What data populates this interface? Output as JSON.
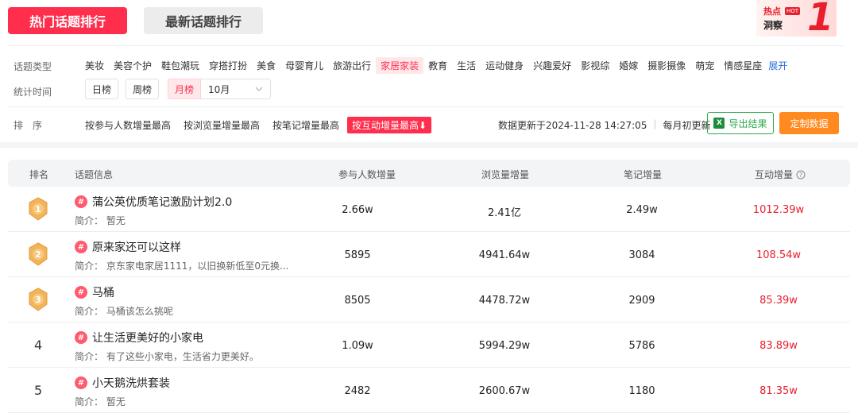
{
  "tabs": [
    {
      "label": "热门话题排行",
      "active": true
    },
    {
      "label": "最新话题排行",
      "active": false
    }
  ],
  "hot_banner": {
    "title": "热点",
    "badge": "HOT",
    "subtitle": "洞察",
    "number": "1"
  },
  "filters": {
    "topic_type_label": "话题类型",
    "topic_types": [
      "美妆",
      "美容个护",
      "鞋包潮玩",
      "穿搭打扮",
      "美食",
      "母婴育儿",
      "旅游出行",
      "家居家装",
      "教育",
      "生活",
      "运动健身",
      "兴趣爱好",
      "影视综",
      "婚嫁",
      "摄影摄像",
      "萌宠",
      "情感星座"
    ],
    "active_topic_type": "家居家装",
    "expand_label": "展开",
    "stat_time_label": "统计时间",
    "periods": [
      "日榜",
      "周榜"
    ],
    "month_label": "月榜",
    "month_value": "10月",
    "sort_label": "排　序",
    "sorts": [
      "按参与人数增量最高",
      "按浏览量增量最高",
      "按笔记增量最高",
      "按互动增量最高⬇"
    ],
    "active_sort": "按互动增量最高⬇"
  },
  "update": {
    "text": "数据更新于2024-11-28 14:27:05",
    "monthly": "每月初更新"
  },
  "buttons": {
    "export": "导出结果",
    "custom": "定制数据"
  },
  "table": {
    "headers": [
      "排名",
      "话题信息",
      "参与人数增量",
      "浏览量增量",
      "笔记增量",
      "互动增量"
    ],
    "rows": [
      {
        "rank": "1",
        "title": "蒲公英优质笔记激励计划2.0",
        "desc": "简介：  暂无",
        "participants": "2.66w",
        "views": "2.41亿",
        "notes": "2.49w",
        "interactions": "1012.39w"
      },
      {
        "rank": "2",
        "title": "原来家还可以这样",
        "desc": "简介：  京东家电家居1111，以旧换新低至0元换...",
        "participants": "5895",
        "views": "4941.64w",
        "notes": "3084",
        "interactions": "108.54w"
      },
      {
        "rank": "3",
        "title": "马桶",
        "desc": "简介：  马桶该怎么挑呢",
        "participants": "8505",
        "views": "4478.72w",
        "notes": "2909",
        "interactions": "85.39w"
      },
      {
        "rank": "4",
        "title": "让生活更美好的小家电",
        "desc": "简介：  有了这些小家电，生活省力更美好。",
        "participants": "1.09w",
        "views": "5994.29w",
        "notes": "5786",
        "interactions": "83.89w"
      },
      {
        "rank": "5",
        "title": "小天鹅洗烘套装",
        "desc": "简介：  暂无",
        "participants": "2482",
        "views": "2600.67w",
        "notes": "1180",
        "interactions": "81.35w"
      }
    ]
  },
  "colors": {
    "primary": "#ff2e4d",
    "medal": "#f2b45a",
    "interaction": "#e8202e"
  }
}
